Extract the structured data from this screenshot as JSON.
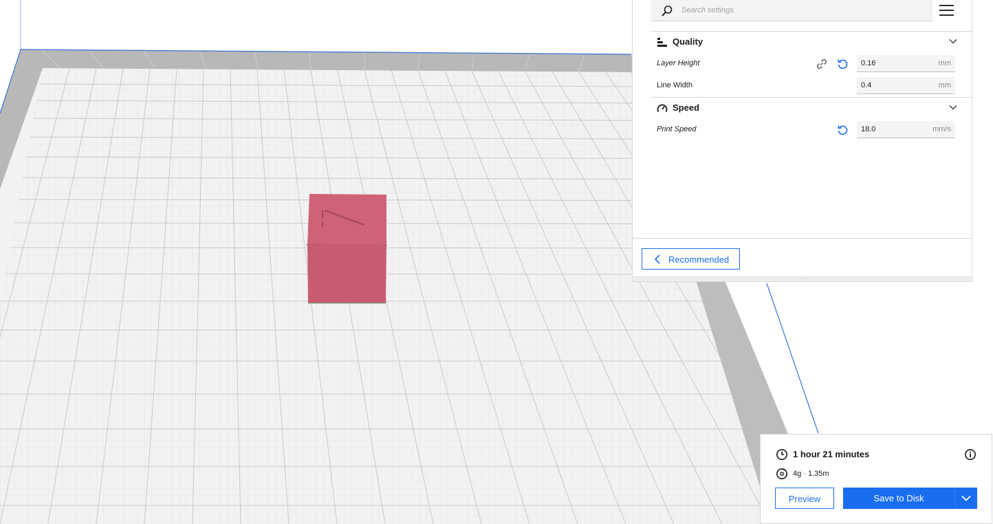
{
  "search": {
    "placeholder": "Search settings"
  },
  "sections": {
    "quality": {
      "title": "Quality"
    },
    "speed": {
      "title": "Speed"
    }
  },
  "settings": {
    "layer_height": {
      "label": "Layer Height",
      "value": "0.16",
      "unit": "mm"
    },
    "line_width": {
      "label": "Line Width",
      "value": "0.4",
      "unit": "mm"
    },
    "print_speed": {
      "label": "Print Speed",
      "value": "18.0",
      "unit": "mm/s"
    }
  },
  "footer": {
    "recommended_label": "Recommended"
  },
  "print_info": {
    "time": "1 hour 21 minutes",
    "material": "4g · 1.35m",
    "preview_label": "Preview",
    "save_label": "Save to Disk"
  },
  "colors": {
    "accent": "#196ef0",
    "model": "#cf6277",
    "plate": "#f2f2f2",
    "plate_border": "#a8a8a8"
  },
  "icons": [
    "search-icon",
    "menu-icon",
    "quality-icon",
    "speed-icon",
    "chevron-down-icon",
    "link-icon",
    "reset-icon",
    "chevron-left-icon",
    "clock-icon",
    "info-icon",
    "spool-icon"
  ]
}
